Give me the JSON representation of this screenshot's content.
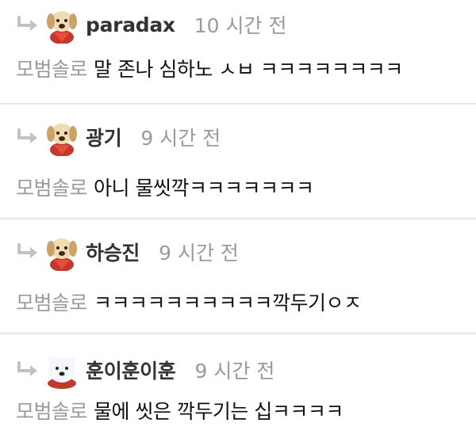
{
  "comments": [
    {
      "author": "paradax",
      "time": "10 시간 전",
      "mention": "모범솔로",
      "text": "말 존나 심하노 ㅅㅂ ㅋㅋㅋㅋㅋㅋㅋㅋ",
      "avatar": "puppy"
    },
    {
      "author": "광기",
      "time": "9 시간 전",
      "mention": "모범솔로",
      "text": "아니 물씻깍ㅋㅋㅋㅋㅋㅋㅋ",
      "avatar": "puppy"
    },
    {
      "author": "하승진",
      "time": "9 시간 전",
      "mention": "모범솔로",
      "text": "ㅋㅋㅋㅋㅋㅋㅋㅋㅋㅋ깍두기ㅇㅈ",
      "avatar": "puppy"
    },
    {
      "author": "훈이훈이훈",
      "time": "9 시간 전",
      "mention": "모범솔로",
      "text": "물에 씻은 깍두기는 십ㅋㅋㅋㅋ",
      "avatar": "bear"
    }
  ],
  "colors": {
    "muted": "#9a9a9a",
    "name": "#333333",
    "divider": "#e6e6e6",
    "reply_icon": "#c2c2c2"
  }
}
